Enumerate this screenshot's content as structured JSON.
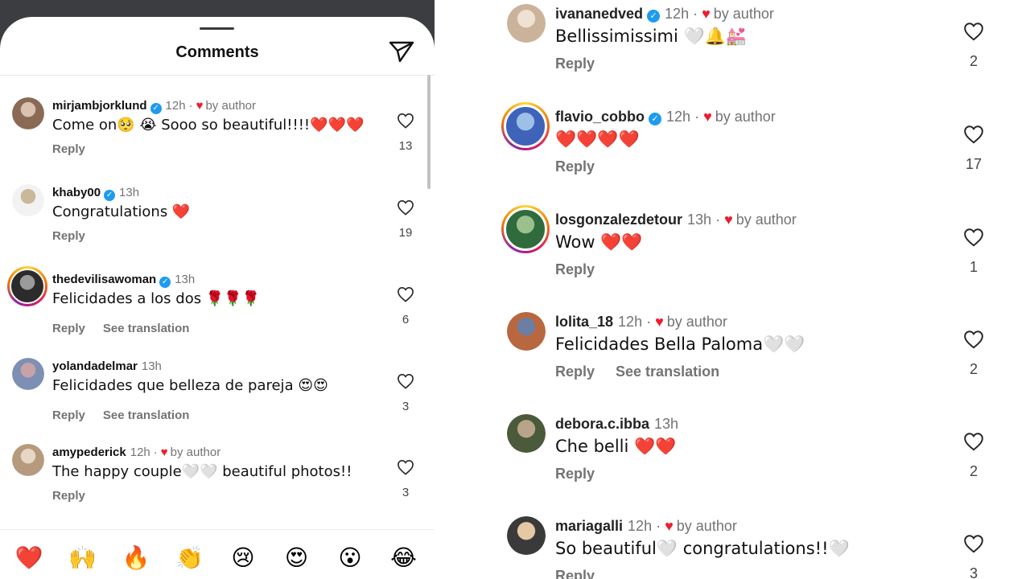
{
  "left": {
    "sheet_title": "Comments",
    "comments": [
      {
        "username": "mirjambjorklund",
        "verified": true,
        "time": "12h",
        "by_author": "by author",
        "text": "Come on🥺 😭 Sooo so beautiful!!!!❤️❤️❤️",
        "reply": "Reply",
        "translation": "",
        "likes": "13",
        "avatar_colors": [
          "#8a6a55",
          "#d9c3b0"
        ]
      },
      {
        "username": "khaby00",
        "verified": true,
        "time": "13h",
        "by_author": "",
        "text": "Congratulations ❤️",
        "reply": "Reply",
        "translation": "",
        "likes": "19",
        "avatar_colors": [
          "#f2f2f2",
          "#c9b89a"
        ]
      },
      {
        "username": "thedevilisawoman",
        "verified": true,
        "time": "13h",
        "by_author": "",
        "text": "Felicidades a los dos 🌹🌹🌹",
        "reply": "Reply",
        "translation": "See translation",
        "likes": "6",
        "avatar_colors": [
          "#2b2b2b",
          "#9b9b9b"
        ],
        "story": true
      },
      {
        "username": "yolandadelmar",
        "verified": false,
        "time": "13h",
        "by_author": "",
        "text": "Felicidades que belleza de pareja 😍😍",
        "reply": "Reply",
        "translation": "See translation",
        "likes": "3",
        "avatar_colors": [
          "#7d8fb3",
          "#c7a3a8"
        ]
      },
      {
        "username": "amypederick",
        "verified": false,
        "time": "12h",
        "by_author": "by author",
        "text": "The happy couple🤍🤍 beautiful photos!!",
        "reply": "Reply",
        "translation": "",
        "likes": "3",
        "avatar_colors": [
          "#b59a7e",
          "#e7d6c3"
        ]
      }
    ],
    "reactions": [
      "❤️",
      "🙌",
      "🔥",
      "👏",
      "😢",
      "😍",
      "😮",
      "😂"
    ]
  },
  "right": {
    "comments": [
      {
        "username": "ivananedved",
        "verified": true,
        "time": "12h",
        "by_author": "by author",
        "text": "Bellissimissimi 🤍🔔💒",
        "reply": "Reply",
        "translation": "",
        "likes": "2",
        "avatar_colors": [
          "#cbb29a",
          "#efe2d2"
        ]
      },
      {
        "username": "flavio_cobbo",
        "verified": true,
        "time": "12h",
        "by_author": "by author",
        "text": "❤️❤️❤️❤️",
        "reply": "Reply",
        "translation": "",
        "likes": "17",
        "avatar_colors": [
          "#3e63b8",
          "#9dc0e6"
        ],
        "story": true
      },
      {
        "username": "losgonzalezdetour",
        "verified": false,
        "time": "13h",
        "by_author": "by author",
        "text": "Wow ❤️❤️",
        "reply": "Reply",
        "translation": "",
        "likes": "1",
        "avatar_colors": [
          "#2f6b3c",
          "#9cc08c"
        ],
        "story": true
      },
      {
        "username": "lolita_18",
        "verified": false,
        "time": "12h",
        "by_author": "by author",
        "text": "Felicidades Bella Paloma🤍🤍",
        "reply": "Reply",
        "translation": "See translation",
        "likes": "2",
        "avatar_colors": [
          "#b9673f",
          "#6a7fa3"
        ]
      },
      {
        "username": "debora.c.ibba",
        "verified": false,
        "time": "13h",
        "by_author": "",
        "text": "Che belli ❤️❤️",
        "reply": "Reply",
        "translation": "",
        "likes": "2",
        "avatar_colors": [
          "#4a5a3b",
          "#b8a48a"
        ]
      },
      {
        "username": "mariagalli",
        "verified": false,
        "time": "12h",
        "by_author": "by author",
        "text": "So beautiful🤍 congratulations!!🤍",
        "reply": "Reply",
        "translation": "",
        "likes": "3",
        "avatar_colors": [
          "#3a3a3a",
          "#e6c8a5"
        ]
      }
    ]
  },
  "colors": {
    "heart_red": "#ed1c2e",
    "muted_text": "#737373",
    "verified_blue": "#1d9bf0",
    "top_bar_dark": "#3b3d40"
  }
}
